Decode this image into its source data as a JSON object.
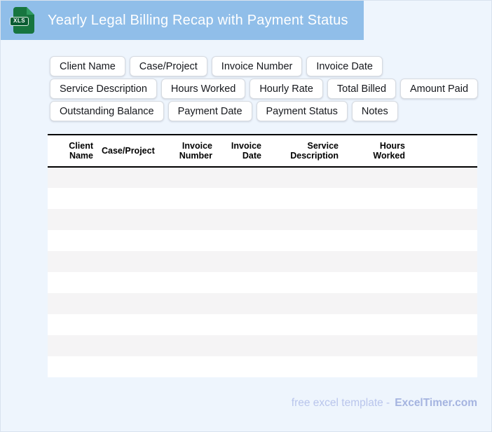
{
  "header": {
    "title": "Yearly Legal Billing Recap with Payment Status",
    "file_badge_label": "XLS"
  },
  "field_chips": [
    "Client Name",
    "Case/Project",
    "Invoice Number",
    "Invoice Date",
    "Service Description",
    "Hours Worked",
    "Hourly Rate",
    "Total Billed",
    "Amount Paid",
    "Outstanding Balance",
    "Payment Date",
    "Payment Status",
    "Notes"
  ],
  "table": {
    "columns": [
      {
        "label": "Client Name",
        "align": "right"
      },
      {
        "label": "Case/Project",
        "align": "left"
      },
      {
        "label": "Invoice Number",
        "align": "right"
      },
      {
        "label": "Invoice Date",
        "align": "right"
      },
      {
        "label": "Service Description",
        "align": "right"
      },
      {
        "label": "Hours Worked",
        "align": "right"
      }
    ],
    "empty_row_count": 10
  },
  "footer": {
    "caption": "free excel template -",
    "brand": "ExcelTimer.com"
  },
  "colors": {
    "banner_blue": "#90bee9",
    "page_background": "#eef5fd",
    "row_stripe_gray": "#f5f4f5",
    "icon_green": "#17753f",
    "icon_fold_green": "#2f9a60",
    "footer_caption": "#b9c5ec",
    "footer_brand": "#a5b4e0"
  }
}
